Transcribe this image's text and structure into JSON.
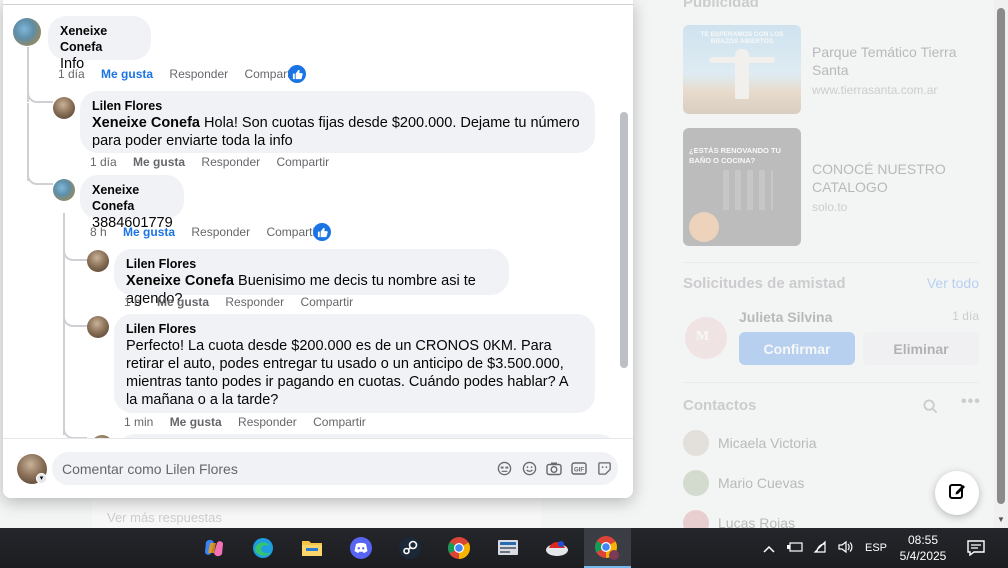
{
  "background": {
    "ads_header": "Publicidad",
    "ads": [
      {
        "title": "Parque Temático Tierra Santa",
        "url": "www.tierrasanta.com.ar",
        "image_text": "TE ESPERAMOS CON LOS BRAZOS ABIERTOS"
      },
      {
        "title": "CONOCÉ NUESTRO CATALOGO",
        "url": "solo.to",
        "image_text": "¿ESTÁS RENOVANDO TU BAÑO O COCINA?"
      }
    ],
    "friend_requests": {
      "header": "Solicitudes de amistad",
      "see_all": "Ver todo",
      "name": "Julieta Silvina",
      "time": "1 día",
      "confirm": "Confirmar",
      "delete": "Eliminar"
    },
    "contacts": {
      "header": "Contactos",
      "items": [
        "Micaela Victoria",
        "Mario Cuevas",
        "Lucas Rojas"
      ]
    },
    "more_replies": "Ver más respuestas"
  },
  "comments": [
    {
      "author": "Xeneixe Conefa",
      "mention": "",
      "text": "Info",
      "time": "1 día",
      "like": "Me gusta",
      "reply": "Responder",
      "share": "Compartir",
      "liked": true
    },
    {
      "author": "Lilen Flores",
      "mention": "Xeneixe Conefa",
      "text": "Hola! Son cuotas fijas desde $200.000. Dejame tu número para poder enviarte toda la info",
      "time": "1 día",
      "like": "Me gusta",
      "reply": "Responder",
      "share": "Compartir",
      "liked": false
    },
    {
      "author": "Xeneixe Conefa",
      "mention": "",
      "text": "3884601779",
      "time": "8 h",
      "like": "Me gusta",
      "reply": "Responder",
      "share": "Compartir",
      "liked": true
    },
    {
      "author": "Lilen Flores",
      "mention": "Xeneixe Conefa",
      "text": "Buenisimo me decis tu nombre asi te agendo?",
      "time": "1 h",
      "like": "Me gusta",
      "reply": "Responder",
      "share": "Compartir",
      "liked": false
    },
    {
      "author": "Lilen Flores",
      "mention": "",
      "text": "Perfecto! La cuota desde $200.000 es de un CRONOS 0KM. Para retirar el auto, podes entregar tu usado o un anticipo de $3.500.000, mientras tanto podes ir pagando en cuotas. Cuándo podes hablar? A la mañana o a la tarde?",
      "time": "1 min",
      "like": "Me gusta",
      "reply": "Responder",
      "share": "Compartir",
      "liked": false
    }
  ],
  "composer": {
    "placeholder": "Comentar como Lilen Flores",
    "icons": [
      "avatar-sticker-icon",
      "emoji-icon",
      "camera-icon",
      "gif-icon",
      "sticker-icon"
    ]
  },
  "taskbar": {
    "apps": [
      "copilot-icon",
      "edge-icon",
      "file-explorer-icon",
      "discord-icon",
      "steam-icon",
      "chrome-icon",
      "app-icon",
      "game-icon",
      "chrome-profile-icon"
    ],
    "language": "ESP",
    "time": "08:55",
    "date": "5/4/2025"
  }
}
